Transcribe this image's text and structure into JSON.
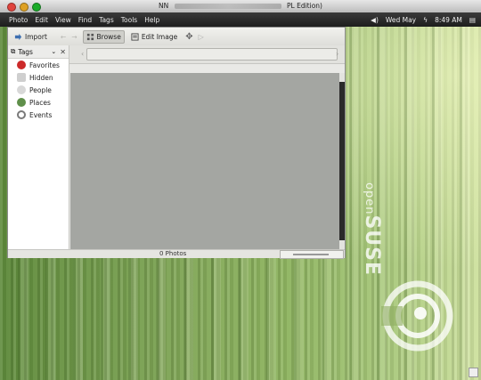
{
  "window": {
    "title_start": "NN",
    "title_end": "PL Edition)"
  },
  "menu": {
    "items": [
      "Photo",
      "Edit",
      "View",
      "Find",
      "Tags",
      "Tools",
      "Help"
    ]
  },
  "panel": {
    "date": "Wed May",
    "time": "8:49 AM",
    "icons": [
      "volume-icon",
      "bolt-icon",
      "network-icon"
    ]
  },
  "toolbar": {
    "import_label": "Import",
    "browse_label": "Browse",
    "edit_image_label": "Edit Image"
  },
  "sidebar": {
    "header_label": "Tags",
    "items": [
      {
        "label": "Favorites",
        "icon": "heart-icon",
        "color": "#cc2a2a"
      },
      {
        "label": "Hidden",
        "icon": "hidden-icon",
        "color": "#cfcfcf"
      },
      {
        "label": "People",
        "icon": "people-icon",
        "color": "#d8d8d8"
      },
      {
        "label": "Places",
        "icon": "globe-icon",
        "color": "#5f8f4a"
      },
      {
        "label": "Events",
        "icon": "clock-icon",
        "color": "#7a7a7a"
      }
    ]
  },
  "status": {
    "photo_count": "0 Photos"
  },
  "desktop": {
    "brand_open": "open",
    "brand_suse": "SUSE"
  }
}
